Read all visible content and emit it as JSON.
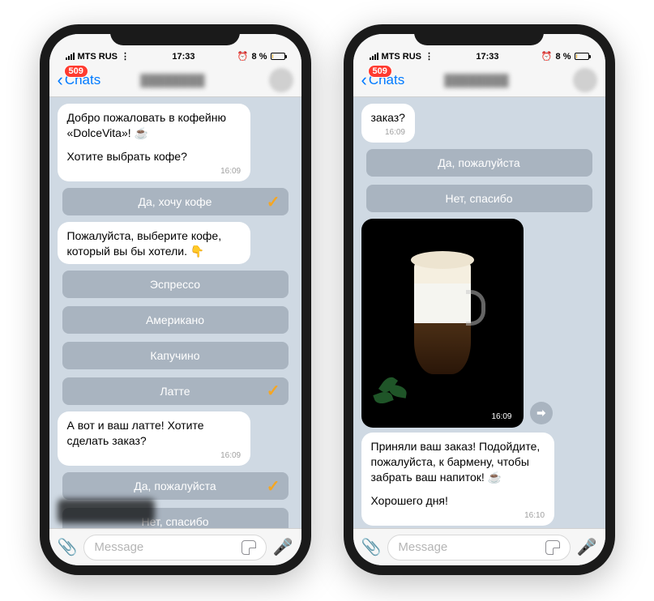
{
  "statusBar": {
    "carrier": "MTS RUS",
    "time": "17:33",
    "battery": "8 %",
    "alarm": "⏰"
  },
  "header": {
    "back": "Chats",
    "badge": "509",
    "blurredTitle": "████████"
  },
  "phone1": {
    "msg1_line1": "Добро пожаловать в кофейню «DolceVita»! ☕",
    "msg1_line2": "Хотите выбрать кофе?",
    "msg1_ts": "16:09",
    "btn_yes_coffee": "Да, хочу кофе",
    "msg2": "Пожалуйста, выберите кофе, который вы бы хотели. 👇",
    "btn_espresso": "Эспрессо",
    "btn_americano": "Американо",
    "btn_cappuccino": "Капучино",
    "btn_latte": "Латте",
    "msg3": "А вот и ваш латте! Хотите сделать заказ?",
    "msg3_ts": "16:09",
    "btn_yes_please": "Да, пожалуйста",
    "btn_no_thanks": "Нет, спасибо"
  },
  "phone2": {
    "msg1": "заказ?",
    "msg1_ts": "16:09",
    "btn_yes_please": "Да, пожалуйста",
    "btn_no_thanks": "Нет, спасибо",
    "photo_ts": "16:09",
    "photo_desc": "latte-glass-photo",
    "msg2_line1": "Приняли ваш заказ! Подойдите, пожалуйста, к бармену, чтобы забрать ваш напиток! ☕",
    "msg2_line2": "Хорошего дня!",
    "msg2_ts": "16:10"
  },
  "input": {
    "placeholder": "Message"
  }
}
